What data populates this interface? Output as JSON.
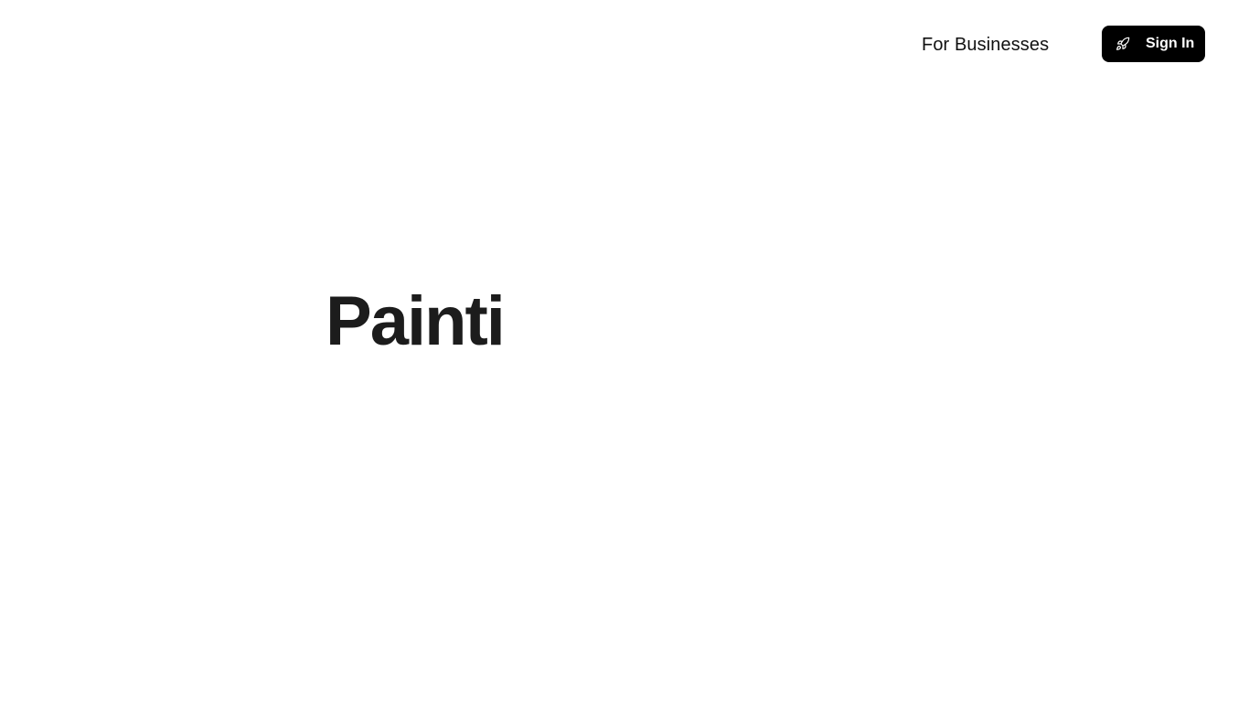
{
  "nav": {
    "for_businesses_label": "For Businesses",
    "sign_in_label": "Sign In",
    "sign_in_icon": "rocket-icon"
  },
  "hero": {
    "title": "Painti"
  },
  "colors": {
    "background": "#ffffff",
    "button_background": "#000000",
    "button_text": "#ffffff",
    "title_text": "#1c1c1c",
    "link_text": "#111111"
  }
}
